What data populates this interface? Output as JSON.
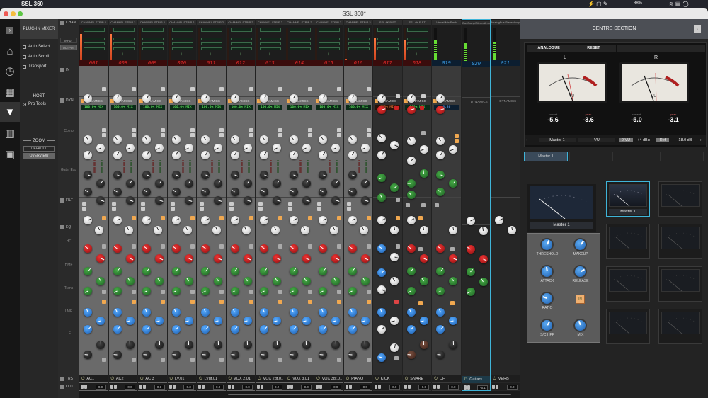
{
  "menubar": {
    "app": "SSL 360",
    "battery": "88%"
  },
  "window": {
    "title": "SSL 360*"
  },
  "panel": {
    "title": "PLUG-IN MIXER",
    "options": [
      {
        "label": "Auto Select",
        "checked": true
      },
      {
        "label": "Auto Scroll",
        "checked": true
      },
      {
        "label": "Transport",
        "checked": false
      }
    ],
    "host_heading": "HOST",
    "host": "Pro Tools",
    "zoom_heading": "ZOOM",
    "zoom_default": "DEFAULT",
    "zoom_overview": "OVERVIEW"
  },
  "sections": {
    "chan": "CHAN",
    "input_btn": "INPUT",
    "output_btn": "OUTPUT",
    "in": "IN",
    "dyn": "DYN",
    "comp": "Comp",
    "gate": "Gate/ Exp",
    "filt": "FILT",
    "eq": "EQ",
    "hf": "HF",
    "hmf": "HMF",
    "trans": "Trans",
    "lmf": "LMF",
    "lf": "LF",
    "trs": "TRS",
    "out": "OUT"
  },
  "channels": [
    {
      "name": "AC1",
      "number": "001",
      "header": "CHANNEL STRIP 2",
      "type": "cs2",
      "output": "0.0",
      "dyn": "DYNAMICS",
      "dyn_display": "100.0% MIX",
      "meter": 0.8
    },
    {
      "name": "AC2",
      "number": "008",
      "header": "CHANNEL STRIP 2",
      "type": "cs2",
      "output": "0.0",
      "dyn": "DYNAMICS",
      "dyn_display": "100.0% MIX",
      "meter": 0.8
    },
    {
      "name": "AC 3",
      "number": "009",
      "header": "CHANNEL STRIP 2",
      "type": "cs2",
      "output": "0.1",
      "dyn": "DYNAMICS",
      "dyn_display": "100.0% MIX",
      "meter": 0
    },
    {
      "name": "LV.01",
      "number": "010",
      "header": "CHANNEL STRIP 2",
      "type": "cs2",
      "output": "0.3",
      "dyn": "DYNAMICS",
      "dyn_display": "100.0% MIX",
      "meter": 0
    },
    {
      "name": "LVdt.01",
      "number": "011",
      "header": "CHANNEL STRIP 2",
      "type": "cs2",
      "output": "0.0",
      "dyn": "DYNAMICS",
      "dyn_display": "100.0% MIX",
      "meter": 0
    },
    {
      "name": "VOX 2.01",
      "number": "012",
      "header": "CHANNEL STRIP 2",
      "type": "cs2",
      "output": "0.0",
      "dyn": "DYNAMICS",
      "dyn_display": "100.0% MIX",
      "meter": 0
    },
    {
      "name": "VOX 2dt.01",
      "number": "013",
      "header": "CHANNEL STRIP 2",
      "type": "cs2",
      "output": "0.2",
      "dyn": "DYNAMICS",
      "dyn_display": "100.0% MIX",
      "meter": 0
    },
    {
      "name": "VOX 3.01",
      "number": "014",
      "header": "CHANNEL STRIP 2",
      "type": "cs2",
      "output": "0.0",
      "dyn": "DYNAMICS",
      "dyn_display": "100.0% MIX",
      "meter": 0
    },
    {
      "name": "VOX 3dt.01",
      "number": "015",
      "header": "CHANNEL STRIP 2",
      "type": "cs2",
      "output": "0.0",
      "dyn": "DYNAMICS",
      "dyn_display": "100.0% MIX",
      "meter": 0
    },
    {
      "name": "PIANO",
      "number": "016",
      "header": "CHANNEL STRIP 2",
      "type": "cs2",
      "output": "0.0",
      "dyn": "DYNAMICS",
      "dyn_display": "100.0% MIX",
      "meter": 0.05
    },
    {
      "name": "KICK",
      "number": "017",
      "header": "SSL 4K B ST",
      "type": "kick",
      "output": "0.0",
      "dyn": "DYNAMICS",
      "dyn_display": "100% MIX",
      "meter": 0.7
    },
    {
      "name": "SNARE_",
      "number": "018",
      "header": "SSL 4K E ST",
      "type": "snare",
      "output": "0.0",
      "dyn": "DYNAMICS",
      "dyn_display": "100% MIX",
      "meter": 0.6
    },
    {
      "name": "OH",
      "number": "019",
      "header": "Virtual Mix Rack",
      "type": "oh",
      "output": "0.0",
      "dyn": "DYNAMICS",
      "dyn_display": "0.30",
      "meter": 0.6
    },
    {
      "name": "Guitars",
      "number": "020",
      "header": "BusComp/StereoAmp",
      "type": "gtr",
      "output": "-6.1",
      "dyn": "DYNAMICS",
      "dyn_display": "",
      "meter": 0.55,
      "selected": true
    },
    {
      "name": "VERB",
      "number": "021",
      "header": "AnalogBus/StereoAmp",
      "type": "verb",
      "output": "0.0",
      "dyn": "DYNAMICS",
      "dyn_display": "",
      "meter": 0.55
    }
  ],
  "centre": {
    "title": "CENTRE SECTION",
    "tabs": [
      "ANALOGUE",
      "RESET",
      "",
      ""
    ],
    "left": {
      "label": "L",
      "current_label": "current",
      "current": "-5.6",
      "peak_label": "peak",
      "peak": "-3.6"
    },
    "right": {
      "label": "R",
      "current_label": "current",
      "current": "-5.0",
      "peak_label": "peak",
      "peak": "-3.1"
    },
    "meter_bar": {
      "source": "Master 1",
      "mode": "VU",
      "zero_vu": "0 VU",
      "level": "+4 dBu",
      "ref_label": "Ref",
      "ref": "-18.0 dB"
    },
    "master_tab": "Master 1",
    "big_meter_label": "Master 1",
    "mini_meters": [
      {
        "label": "Master 1",
        "active": true
      },
      {
        "label": "",
        "active": false
      },
      {
        "label": "",
        "active": false
      },
      {
        "label": "",
        "active": false
      },
      {
        "label": "",
        "active": false
      },
      {
        "label": "",
        "active": false
      },
      {
        "label": "",
        "active": false
      },
      {
        "label": "",
        "active": false
      }
    ],
    "comp": {
      "threshold": "THRESHOLD",
      "makeup": "MAKEUP",
      "attack": "ATTACK",
      "release": "RELEASE",
      "ratio": "RATIO",
      "in": "IN",
      "schpf": "S/C HPF",
      "mix": "MIX"
    }
  },
  "colors": {
    "accent": "#3fb4d8",
    "meter_red": "#d04420",
    "knob_red": "#c1121a",
    "knob_green": "#2f8a3a",
    "knob_blue": "#2e7fd0"
  }
}
